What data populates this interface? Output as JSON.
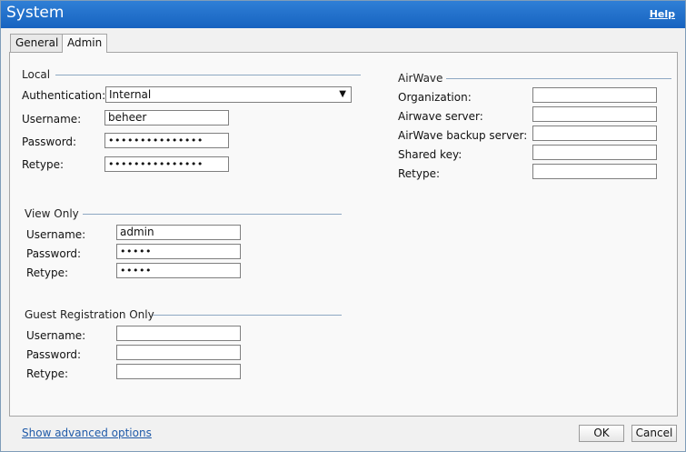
{
  "window": {
    "title": "System",
    "help_label": "Help"
  },
  "tabs": [
    {
      "label": "General"
    },
    {
      "label": "Admin"
    }
  ],
  "local": {
    "legend": "Local",
    "authentication_label": "Authentication:",
    "authentication_value": "Internal",
    "username_label": "Username:",
    "username_value": "beheer",
    "password_label": "Password:",
    "password_value": "•••••••••••••••",
    "retype_label": "Retype:",
    "retype_value": "•••••••••••••••"
  },
  "view_only": {
    "legend": "View Only",
    "username_label": "Username:",
    "username_value": "admin",
    "password_label": "Password:",
    "password_value": "•••••",
    "retype_label": "Retype:",
    "retype_value": "•••••"
  },
  "guest_registration": {
    "legend": "Guest Registration Only",
    "username_label": "Username:",
    "password_label": "Password:",
    "retype_label": "Retype:"
  },
  "airwave": {
    "legend": "AirWave",
    "organization_label": "Organization:",
    "server_label": "Airwave server:",
    "backup_server_label": "AirWave backup server:",
    "shared_key_label": "Shared key:",
    "retype_label": "Retype:"
  },
  "footer": {
    "advanced_link": "Show advanced options",
    "ok_label": "OK",
    "cancel_label": "Cancel"
  }
}
